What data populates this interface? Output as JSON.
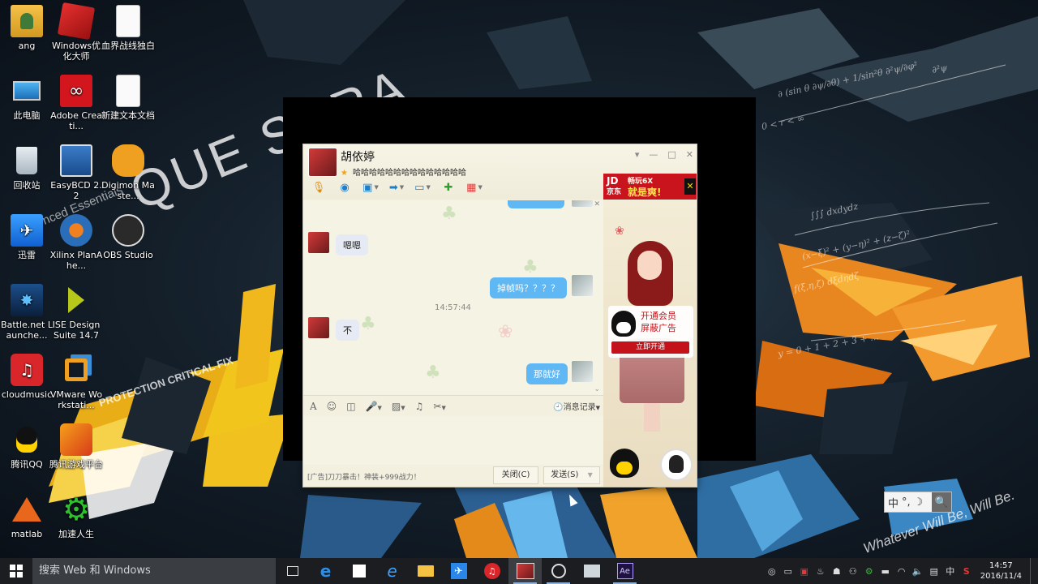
{
  "desktop": {
    "icons": [
      {
        "label": "ang"
      },
      {
        "label": "Windows优化大师"
      },
      {
        "label": "血界战线独白"
      },
      {
        "label": "此电脑"
      },
      {
        "label": "Adobe Creati..."
      },
      {
        "label": "新建文本文档"
      },
      {
        "label": "回收站"
      },
      {
        "label": "EasyBCD 2.2"
      },
      {
        "label": "Digimon Maste..."
      },
      {
        "label": "迅雷"
      },
      {
        "label": "Xilinx PlanAhe..."
      },
      {
        "label": "OBS Studio"
      },
      {
        "label": "Battle.net Launche..."
      },
      {
        "label": "ISE Design Suite 14.7"
      },
      {
        "label": "cloudmusic"
      },
      {
        "label": "VMware Workstati..."
      },
      {
        "label": "腾讯QQ"
      },
      {
        "label": "腾讯游戏平台"
      },
      {
        "label": "matlab"
      },
      {
        "label": "加速人生"
      }
    ],
    "wallpaper_text": {
      "sera": "QUE SERA",
      "enhanced": "nced Essentials",
      "fix": "PROTECTION CRITICAL FIX",
      "whatever": "Whatever Will Be, Will Be."
    }
  },
  "qq_window": {
    "contact_name": "胡依婷",
    "signature": "哈哈哈哈哈哈哈哈哈哈哈哈哈哈",
    "window_controls": [
      "▾",
      "—",
      "□",
      "✕"
    ],
    "ad_banner": {
      "brand": "JD",
      "brand_sub": "京东",
      "text_line1": "畅玩6X",
      "text_line2": "就是爽!",
      "close": "✕"
    },
    "messages": [
      {
        "side": "left",
        "text": "嗯嗯"
      },
      {
        "side": "right",
        "text": "掉帧吗？？？？"
      },
      {
        "side": "time",
        "text": "14:57:44"
      },
      {
        "side": "left",
        "text": "不"
      },
      {
        "side": "right",
        "text": "那就好"
      }
    ],
    "input_tools": {
      "history_label": "消息记录"
    },
    "footer": {
      "ad_line": "[广告]刀刀暴击！神装+999战力！",
      "close_button": "关闭(C)",
      "send_button": "发送(S)"
    },
    "side_ad": {
      "line1": "开通会员",
      "line2": "屏蔽广告",
      "button": "立即开通"
    }
  },
  "ime_bar": {
    "mode": "中",
    "punct": "°,",
    "moon": "☽"
  },
  "taskbar": {
    "search_placeholder": "搜索 Web 和 Windows",
    "tray_lang": "中",
    "clock_time": "14:57",
    "clock_date": "2016/11/4"
  },
  "colors": {
    "bubble_right": "#5fb7f3",
    "bubble_left": "#e6eaf4",
    "taskbar_bg": "#1b1d21",
    "vip_red": "#c4121b"
  }
}
